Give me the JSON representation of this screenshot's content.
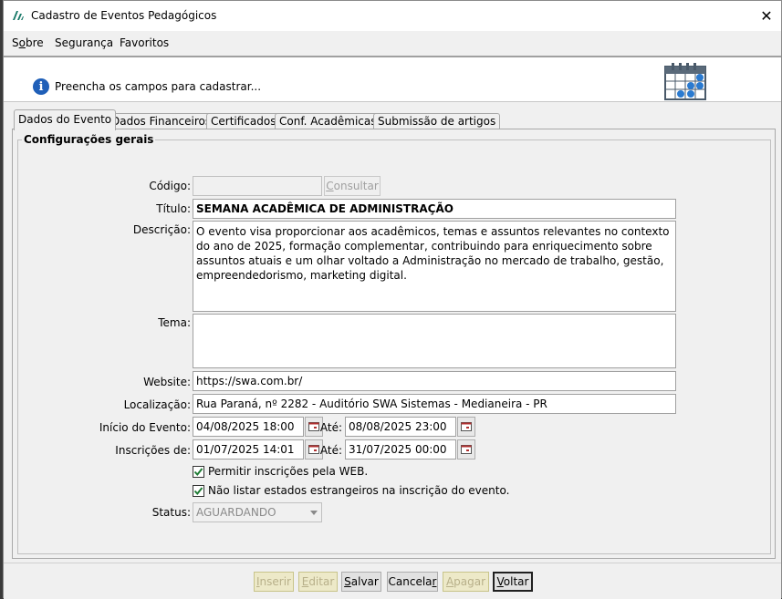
{
  "window": {
    "title": "Cadastro de Eventos Pedagógicos",
    "close_glyph": "✕"
  },
  "menu": {
    "items": [
      {
        "label": "Sobre",
        "mnemonic": "o"
      },
      {
        "label": "Segurança"
      },
      {
        "label": "Favoritos"
      }
    ]
  },
  "header": {
    "info_glyph": "i",
    "message": "Preencha os campos para cadastrar..."
  },
  "tabs": [
    {
      "label": "Dados do Evento",
      "active": true
    },
    {
      "label": "Dados Financeiros"
    },
    {
      "label": "Certificados"
    },
    {
      "label": "Conf. Acadêmicas"
    },
    {
      "label": "Submissão de artigos"
    }
  ],
  "form": {
    "group_title": "Configurações gerais",
    "codigo": {
      "label": "Código:",
      "value": "",
      "consult_label": "Consultar"
    },
    "titulo": {
      "label": "Título:",
      "value": "SEMANA ACADÊMICA DE ADMINISTRAÇÃO"
    },
    "descricao": {
      "label": "Descrição:",
      "value": "O evento visa proporcionar aos acadêmicos, temas e assuntos relevantes no contexto do ano de 2025, formação complementar, contribuindo para enriquecimento sobre assuntos atuais e um olhar voltado a Administração no mercado de trabalho, gestão, empreendedorismo, marketing digital."
    },
    "tema": {
      "label": "Tema:",
      "value": ""
    },
    "website": {
      "label": "Website:",
      "value": "https://swa.com.br/"
    },
    "localizacao": {
      "label": "Localização:",
      "value": "Rua Paraná, nº 2282 - Auditório SWA Sistemas - Medianeira - PR"
    },
    "inicio": {
      "label": "Início do Evento:",
      "value": "04/08/2025 18:00",
      "ate_label": "Até:",
      "ate_value": "08/08/2025 23:00"
    },
    "inscricoes": {
      "label": "Inscrições de:",
      "value": "01/07/2025 14:01",
      "ate_label": "Até:",
      "ate_value": "31/07/2025 00:00"
    },
    "check_web": {
      "label": "Permitir inscrições pela WEB.",
      "checked": true
    },
    "check_estrangeiros": {
      "label": "Não listar estados estrangeiros na inscrição do evento.",
      "checked": true
    },
    "status": {
      "label": "Status:",
      "value": "AGUARDANDO"
    }
  },
  "footer": {
    "buttons": {
      "inserir": "Inserir",
      "editar": "Editar",
      "salvar": "Salvar",
      "cancelar": "Cancelar",
      "apagar": "Apagar",
      "voltar": "Voltar"
    }
  },
  "colors": {
    "info_blue": "#1f5fb8",
    "disabled_yellow": "#ede9c8",
    "check_green": "#1e7b34"
  }
}
